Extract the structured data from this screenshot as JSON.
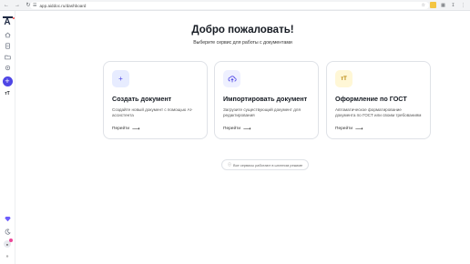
{
  "browser": {
    "url": "app.aiddoc.ru/dashboard",
    "back_icon": "arrow-left-icon",
    "forward_icon": "arrow-right-icon",
    "reload_icon": "reload-icon"
  },
  "sidebar": {
    "logo_text": "A",
    "icons": [
      "home-icon",
      "document-icon",
      "folder-icon",
      "settings-icon"
    ],
    "add_label": "+",
    "tt_label": "ᴛT"
  },
  "main": {
    "title": "Добро пожаловать!",
    "subtitle": "Выберите сервис для работы с документами",
    "cards": [
      {
        "icon": "plus-icon",
        "icon_glyph": "+",
        "icon_color": "#4f46e5",
        "icon_bg": "#e7ecff",
        "title": "Создать документ",
        "description": "Создайте новый документ с помощью AI-ассистента",
        "action": "Перейти"
      },
      {
        "icon": "cloud-upload-icon",
        "icon_glyph": "",
        "icon_color": "#4f46e5",
        "icon_bg": "#eef0ff",
        "title": "Импортировать документ",
        "description": "Загрузите существующий документ для редактирования",
        "action": "Перейти"
      },
      {
        "icon": "text-format-icon",
        "icon_glyph": "ᴛT",
        "icon_color": "#b58100",
        "icon_bg": "#fff7d6",
        "title": "Оформление по ГОСТ",
        "description": "Автоматическое форматирование документа по ГОСТ или своим требованиям",
        "action": "Перейти"
      }
    ],
    "note": "Все сервисы работают в штатном режиме"
  }
}
